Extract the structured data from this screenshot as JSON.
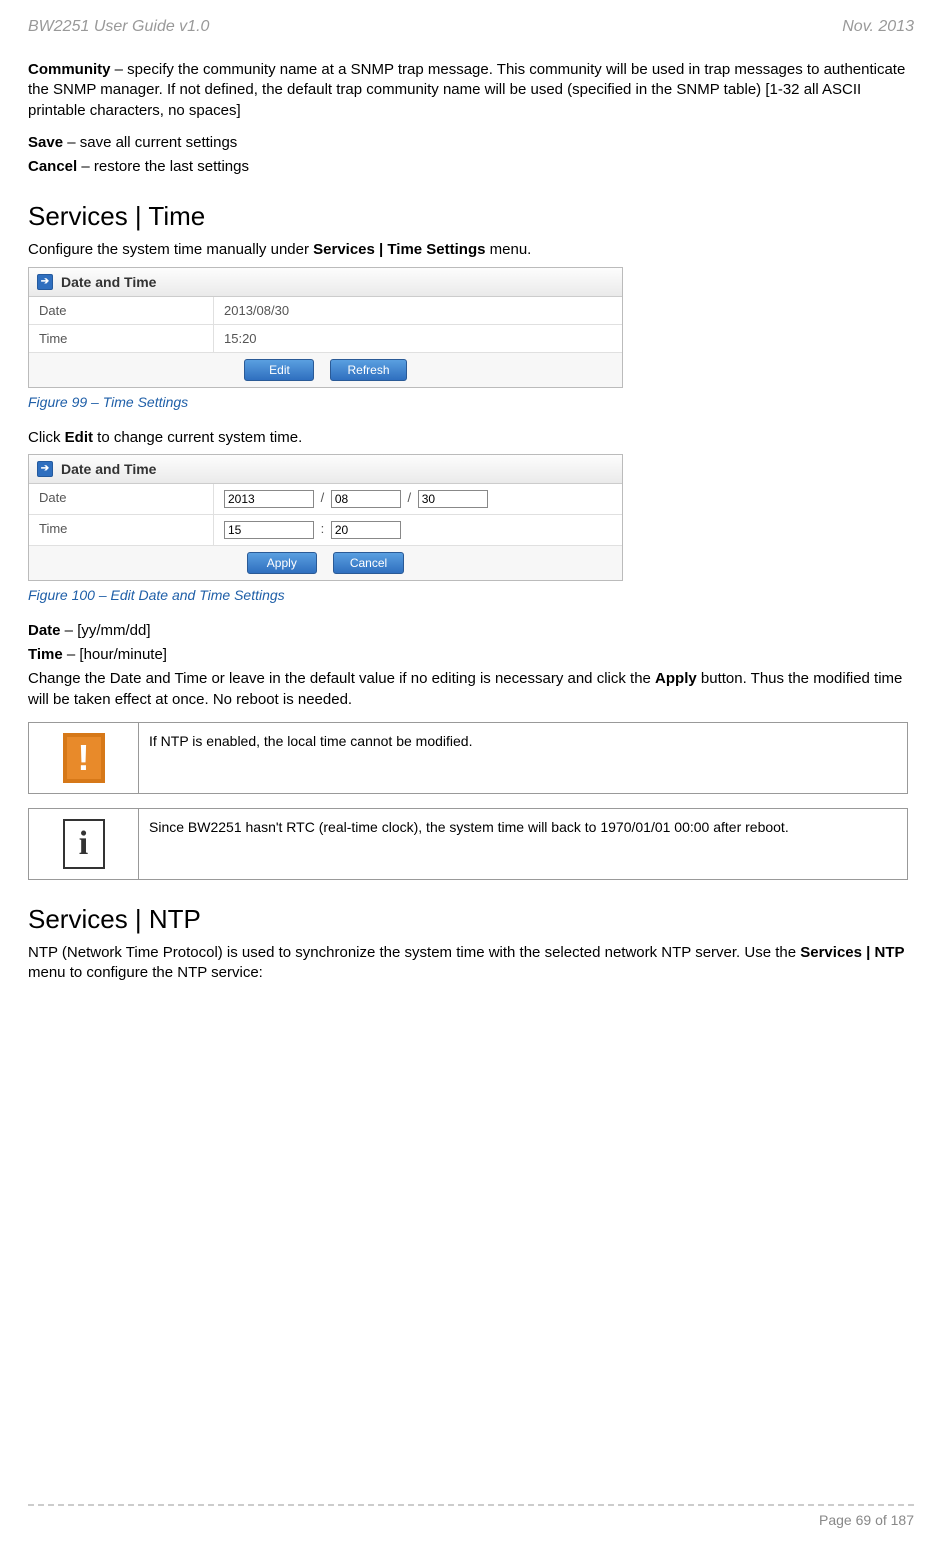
{
  "header": {
    "left": "BW2251 User Guide v1.0",
    "right": "Nov.  2013"
  },
  "intro": {
    "community_label": "Community",
    "community_text": " – specify the community name at a SNMP trap message. This community will be used in trap messages to authenticate the SNMP manager. If not defined, the default trap community name will be used (specified in the SNMP table) [1-32 all ASCII printable characters, no spaces]",
    "save_label": "Save",
    "save_text": " – save all current settings",
    "cancel_label": "Cancel",
    "cancel_text": " – restore the last settings"
  },
  "time_section": {
    "heading": "Services | Time",
    "desc_pre": "Configure the system time manually under ",
    "desc_bold": "Services | Time Settings",
    "desc_post": " menu.",
    "panel_title": "Date and Time",
    "date_label": "Date",
    "date_value": "2013/08/30",
    "time_label": "Time",
    "time_value": "15:20",
    "edit_btn": "Edit",
    "refresh_btn": "Refresh",
    "figure99": "Figure 99 – Time Settings",
    "click_pre": "Click ",
    "click_bold": "Edit",
    "click_post": " to change current system time.",
    "edit_year": "2013",
    "edit_month": "08",
    "edit_day": "30",
    "edit_hour": "15",
    "edit_min": "20",
    "apply_btn": "Apply",
    "cancel_btn": "Cancel",
    "figure100": "Figure 100 – Edit Date and Time Settings",
    "date_fmt_label": "Date",
    "date_fmt_text": " – [yy/mm/dd]",
    "time_fmt_label": "Time",
    "time_fmt_text": " – [hour/minute]",
    "change_pre": "Change the Date and Time or leave in the default value if no editing is necessary and click the ",
    "change_bold": "Apply",
    "change_post": " button. Thus the modified time will be taken effect at once. No reboot is needed.",
    "warn_text": "If NTP is enabled, the local time cannot be modified.",
    "info_text": "Since BW2251 hasn't RTC (real-time clock), the system time will back to 1970/01/01 00:00 after reboot."
  },
  "ntp_section": {
    "heading": "Services | NTP",
    "desc_pre": "NTP (Network Time Protocol) is used to synchronize the system time with the selected network NTP server. Use the ",
    "desc_bold": "Services | NTP",
    "desc_post": " menu to configure the NTP service:"
  },
  "footer": {
    "page": "Page 69 of 187"
  }
}
